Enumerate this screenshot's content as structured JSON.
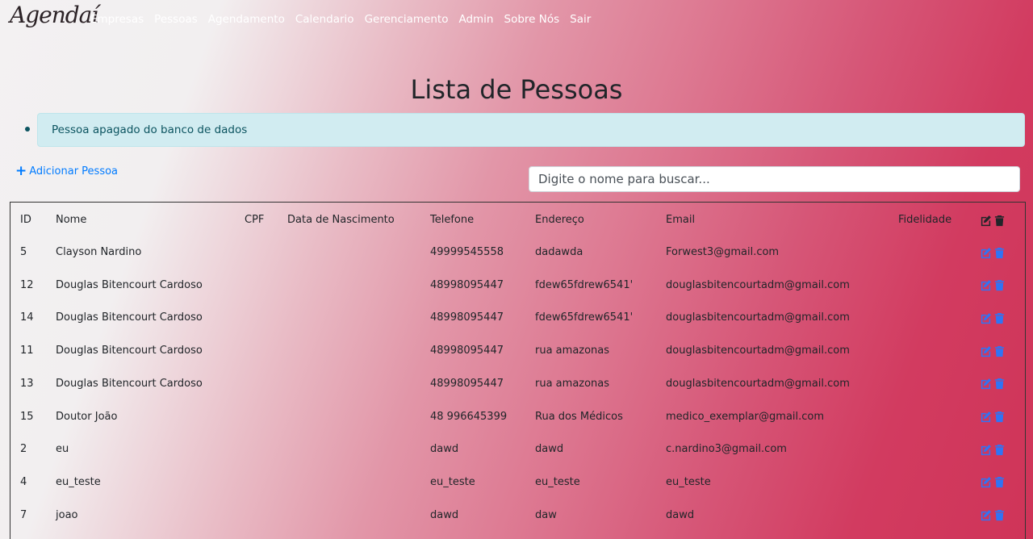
{
  "nav": {
    "brand": "Agendaí",
    "links": [
      "Empresas",
      "Pessoas",
      "Agendamento",
      "Calendario",
      "Gerenciamento",
      "Admin",
      "Sobre Nós",
      "Sair"
    ]
  },
  "page": {
    "title": "Lista de Pessoas",
    "alert": "Pessoa apagado do banco de dados",
    "add_label": "Adicionar Pessoa",
    "search_placeholder": "Digite o nome para buscar..."
  },
  "table": {
    "headers": {
      "id": "ID",
      "nome": "Nome",
      "cpf": "CPF",
      "nasc": "Data de Nascimento",
      "tel": "Telefone",
      "end": "Endereço",
      "email": "Email",
      "fid": "Fidelidade"
    },
    "rows": [
      {
        "id": "5",
        "nome": "Clayson Nardino",
        "cpf": "",
        "nasc": "",
        "tel": "49999545558",
        "end": "dadawda",
        "email": "Forwest3@gmail.com",
        "fid": ""
      },
      {
        "id": "12",
        "nome": "Douglas Bitencourt Cardoso",
        "cpf": "",
        "nasc": "",
        "tel": "48998095447",
        "end": "fdew65fdrew6541'",
        "email": "douglasbitencourtadm@gmail.com",
        "fid": ""
      },
      {
        "id": "14",
        "nome": "Douglas Bitencourt Cardoso",
        "cpf": "",
        "nasc": "",
        "tel": "48998095447",
        "end": "fdew65fdrew6541'",
        "email": "douglasbitencourtadm@gmail.com",
        "fid": ""
      },
      {
        "id": "11",
        "nome": "Douglas Bitencourt Cardoso",
        "cpf": "",
        "nasc": "",
        "tel": "48998095447",
        "end": "rua amazonas",
        "email": "douglasbitencourtadm@gmail.com",
        "fid": ""
      },
      {
        "id": "13",
        "nome": "Douglas Bitencourt Cardoso",
        "cpf": "",
        "nasc": "",
        "tel": "48998095447",
        "end": "rua amazonas",
        "email": "douglasbitencourtadm@gmail.com",
        "fid": ""
      },
      {
        "id": "15",
        "nome": "Doutor João",
        "cpf": "",
        "nasc": "",
        "tel": "48 996645399",
        "end": "Rua dos Médicos",
        "email": "medico_exemplar@gmail.com",
        "fid": ""
      },
      {
        "id": "2",
        "nome": "eu",
        "cpf": "",
        "nasc": "",
        "tel": "dawd",
        "end": "dawd",
        "email": "c.nardino3@gmail.com",
        "fid": ""
      },
      {
        "id": "4",
        "nome": "eu_teste",
        "cpf": "",
        "nasc": "",
        "tel": "eu_teste",
        "end": "eu_teste",
        "email": "eu_teste",
        "fid": ""
      },
      {
        "id": "7",
        "nome": "joao",
        "cpf": "",
        "nasc": "",
        "tel": "dawd",
        "end": "daw",
        "email": "dawd",
        "fid": ""
      }
    ]
  },
  "colors": {
    "link": "#007bff",
    "alert_bg": "#d1ecf1",
    "alert_text": "#0c5460",
    "header_icon": "#212529"
  },
  "icons": {
    "edit": "edit-icon",
    "delete": "trash-icon"
  }
}
